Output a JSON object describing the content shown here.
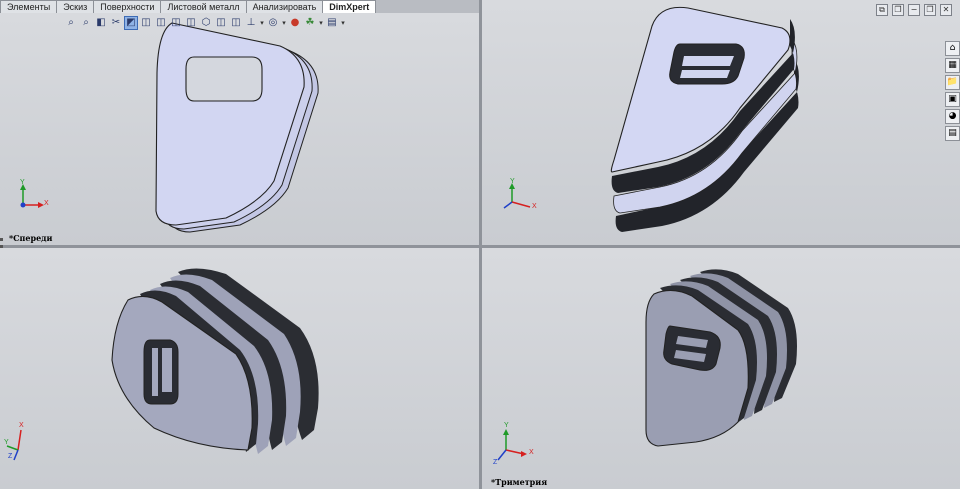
{
  "tabs": [
    {
      "label": "Элементы",
      "active": false
    },
    {
      "label": "Эскиз",
      "active": false
    },
    {
      "label": "Поверхности",
      "active": false
    },
    {
      "label": "Листовой металл",
      "active": false
    },
    {
      "label": "Анализировать",
      "active": false
    },
    {
      "label": "DimXpert",
      "active": true
    }
  ],
  "heads_up_toolbar": [
    {
      "icon": "zoom-to-fit-icon",
      "glyph": "⌕"
    },
    {
      "icon": "zoom-area-icon",
      "glyph": "⌕"
    },
    {
      "icon": "previous-view-icon",
      "glyph": "◧"
    },
    {
      "icon": "section-view-icon",
      "glyph": "✂"
    },
    {
      "icon": "view-orientation-icon",
      "glyph": "◩"
    },
    {
      "icon": "display-style-icon",
      "glyph": "◫"
    },
    {
      "icon": "hide-show-icon",
      "glyph": "◫"
    },
    {
      "icon": "edit-appearance-icon",
      "glyph": "◫"
    },
    {
      "icon": "scene-icon",
      "glyph": "◫"
    },
    {
      "icon": "view-settings-icon",
      "glyph": "⬡"
    },
    {
      "icon": "rendering-icon",
      "glyph": "◫"
    },
    {
      "icon": "shadows-icon",
      "glyph": "◫"
    },
    {
      "icon": "triad-icon",
      "glyph": "⊥"
    },
    {
      "icon": "views-icon",
      "glyph": "◎"
    },
    {
      "icon": "appearance-icon",
      "glyph": "●"
    },
    {
      "icon": "scene-apply-icon",
      "glyph": "☘"
    },
    {
      "icon": "screen-capture-icon",
      "glyph": "▤"
    }
  ],
  "window_controls": [
    {
      "icon": "tile-icon",
      "glyph": "⧉"
    },
    {
      "icon": "restore-icon",
      "glyph": "❐"
    },
    {
      "icon": "minimize-icon",
      "glyph": "−"
    },
    {
      "icon": "maximize-icon",
      "glyph": "❐"
    },
    {
      "icon": "close-icon",
      "glyph": "✕"
    }
  ],
  "task_pane": [
    {
      "icon": "resources-icon",
      "glyph": "⌂"
    },
    {
      "icon": "design-library-icon",
      "glyph": "▦"
    },
    {
      "icon": "file-explorer-icon",
      "glyph": "📁"
    },
    {
      "icon": "view-palette-icon",
      "glyph": "▣"
    },
    {
      "icon": "appearances-icon",
      "glyph": "◕"
    },
    {
      "icon": "custom-properties-icon",
      "glyph": "▤"
    }
  ],
  "viewports": {
    "top_left": {
      "label": "*Спереди"
    },
    "bottom_right": {
      "label": "*Триметрия"
    }
  },
  "axes": {
    "x": "X",
    "y": "Y",
    "z": "Z"
  },
  "colors": {
    "x_axis": "#d62020",
    "y_axis": "#1f9a28",
    "z_axis": "#2040c8",
    "part_face": "#cfd3ee",
    "part_side": "#2b2d33"
  }
}
